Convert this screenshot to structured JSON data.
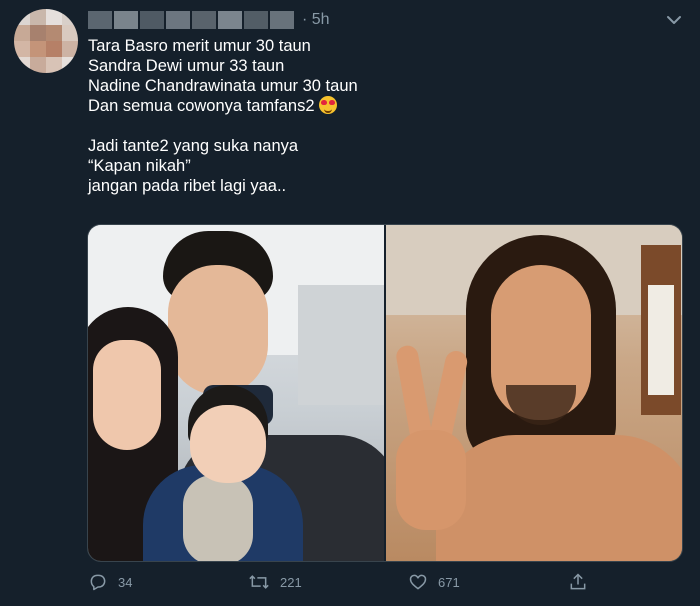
{
  "tweet": {
    "time": "5h",
    "lines": [
      "Tara Basro merit umur 30 taun",
      "Sandra Dewi umur 33 taun",
      "Nadine Chandrawinata umur 30 taun",
      "Dan semua cowonya tamfans2",
      "Jadi tante2 yang suka nanya",
      "“Kapan nikah”",
      "jangan pada ribet lagi yaa.."
    ],
    "emoji": "smiling-face-with-heart-eyes"
  },
  "actions": {
    "reply_count": "34",
    "retweet_count": "221",
    "like_count": "671"
  },
  "icons": {
    "reply": "reply-icon",
    "retweet": "retweet-icon",
    "like": "heart-icon",
    "share": "share-icon",
    "caret": "chevron-down-icon"
  },
  "colors": {
    "background": "#15202b",
    "text": "#ffffff",
    "secondary": "#8899a6",
    "border": "#38444d"
  }
}
